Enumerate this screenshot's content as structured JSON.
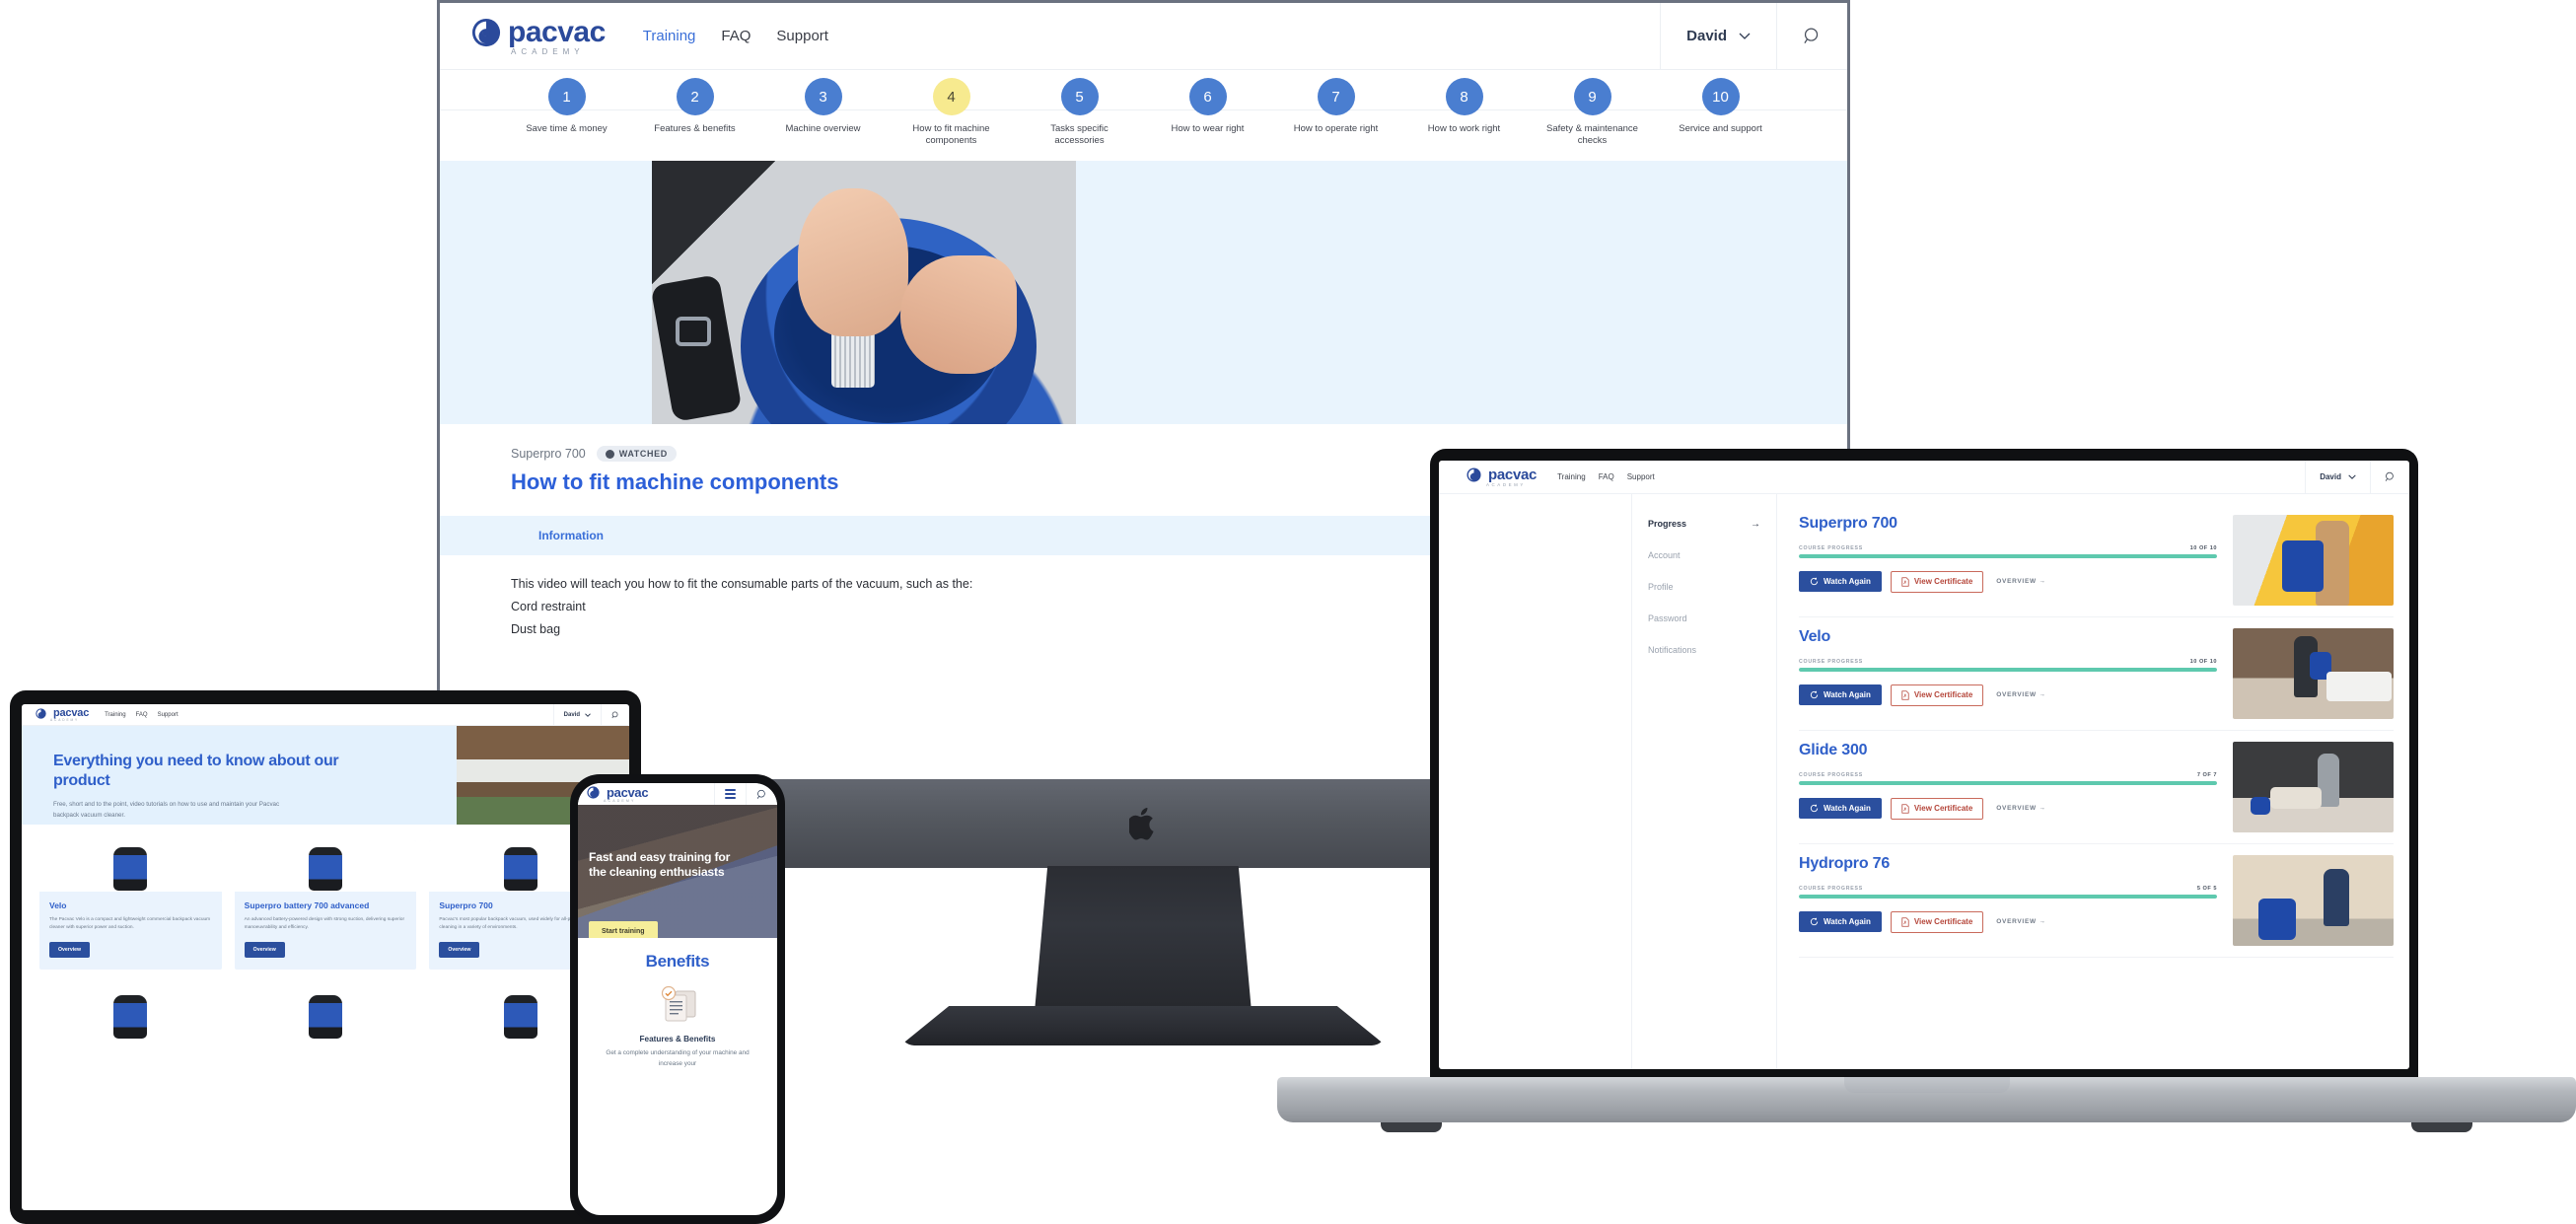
{
  "brand": {
    "name": "pacvac",
    "sub": "ACADEMY",
    "color_primary": "#2b4a9b",
    "color_link": "#3a6fd8",
    "color_progress": "#5ec9ae",
    "color_highlight": "#f7ea8f",
    "color_cert": "#b5463a"
  },
  "desktop": {
    "nav": [
      {
        "label": "Training",
        "active": true
      },
      {
        "label": "FAQ",
        "active": false
      },
      {
        "label": "Support",
        "active": false
      }
    ],
    "user": {
      "name": "David",
      "chevron_icon": "chevron-down-icon"
    },
    "search_icon": "search-icon",
    "steps": [
      {
        "number": "1",
        "label": "Save time & money",
        "current": false
      },
      {
        "number": "2",
        "label": "Features & benefits",
        "current": false
      },
      {
        "number": "3",
        "label": "Machine overview",
        "current": false
      },
      {
        "number": "4",
        "label": "How to fit machine components",
        "current": true
      },
      {
        "number": "5",
        "label": "Tasks specific accessories",
        "current": false
      },
      {
        "number": "6",
        "label": "How to wear right",
        "current": false
      },
      {
        "number": "7",
        "label": "How to operate right",
        "current": false
      },
      {
        "number": "8",
        "label": "How to work right",
        "current": false
      },
      {
        "number": "9",
        "label": "Safety & maintenance checks",
        "current": false
      },
      {
        "number": "10",
        "label": "Service and support",
        "current": false
      }
    ],
    "lesson": {
      "product": "Superpro 700",
      "watched_badge": "WATCHED",
      "title": "How to fit machine components",
      "tab": "Information",
      "body_line1": "This video will teach you how to fit the consumable parts of the vacuum, such as the:",
      "body_line2": "Cord restraint",
      "body_line3": "Dust bag"
    }
  },
  "laptop": {
    "nav": [
      {
        "label": "Training"
      },
      {
        "label": "FAQ"
      },
      {
        "label": "Support"
      }
    ],
    "user": {
      "name": "David"
    },
    "sidebar": [
      {
        "label": "Progress",
        "active": true,
        "arrow": "→"
      },
      {
        "label": "Account",
        "active": false
      },
      {
        "label": "Profile",
        "active": false
      },
      {
        "label": "Password",
        "active": false
      },
      {
        "label": "Notifications",
        "active": false
      }
    ],
    "progress_label": "COURSE PROGRESS",
    "watch_label": "Watch Again",
    "cert_label": "View Certificate",
    "overview_label": "OVERVIEW  →",
    "courses": [
      {
        "title": "Superpro 700",
        "progress_text": "10 OF 10",
        "percent": 100,
        "thumb": "th1"
      },
      {
        "title": "Velo",
        "progress_text": "10 OF 10",
        "percent": 100,
        "thumb": "th2"
      },
      {
        "title": "Glide 300",
        "progress_text": "7 OF 7",
        "percent": 100,
        "thumb": "th3"
      },
      {
        "title": "Hydropro 76",
        "progress_text": "5 OF 5",
        "percent": 100,
        "thumb": "th4"
      }
    ]
  },
  "tablet": {
    "nav": [
      {
        "label": "Training"
      },
      {
        "label": "FAQ"
      },
      {
        "label": "Support"
      }
    ],
    "user": {
      "name": "David"
    },
    "hero": {
      "heading": "Everything you need to know about our product",
      "subtext": "Free, short and to the point, video tutorials on how to use and maintain your Pacvac backpack vacuum cleaner."
    },
    "cards": [
      {
        "title": "Velo",
        "desc": "The Pacvac Velo is a compact and lightweight commercial backpack vacuum cleaner with superior power and suction.",
        "button": "Overview"
      },
      {
        "title": "Superpro battery 700 advanced",
        "desc": "An advanced battery-powered design with strong suction, delivering superior manoeuvrability and efficiency.",
        "button": "Overview"
      },
      {
        "title": "Superpro 700",
        "desc": "Pacvac's most popular backpack vacuum, used widely for all-purpose cleaning in a variety of environments.",
        "button": "Overview"
      }
    ]
  },
  "phone": {
    "menu_icon": "hamburger-menu-icon",
    "search_icon": "search-icon",
    "hero_heading": "Fast and easy training for the cleaning enthusiasts",
    "cta_label": "Start training",
    "benefits_heading": "Benefits",
    "benefit_icon": "document-check-icon",
    "benefit_title": "Features & Benefits",
    "benefit_desc": "Get a complete understanding of your machine and increase your"
  }
}
